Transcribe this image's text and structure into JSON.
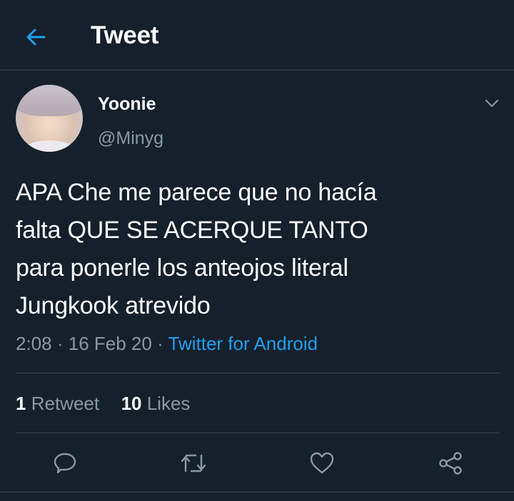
{
  "header": {
    "title": "Tweet",
    "back_icon": "arrow-left-icon"
  },
  "accent_color": "#1da1f2",
  "tweet": {
    "author": {
      "name": "Yoonie",
      "handle": "@Minyg"
    },
    "text_lines": [
      "APA Che me parece que no hacía",
      "falta QUE SE ACERQUE TANTO",
      "para ponerle los anteojos literal",
      "Jungkook atrevido"
    ],
    "time": "2:08",
    "date": "16 Feb 20",
    "separator": "·",
    "source": "Twitter for Android",
    "stats": {
      "retweets_count": "1",
      "retweets_label": "Retweet",
      "likes_count": "10",
      "likes_label": "Likes"
    }
  },
  "actions": [
    "reply-icon",
    "retweet-icon",
    "like-icon",
    "share-icon"
  ]
}
